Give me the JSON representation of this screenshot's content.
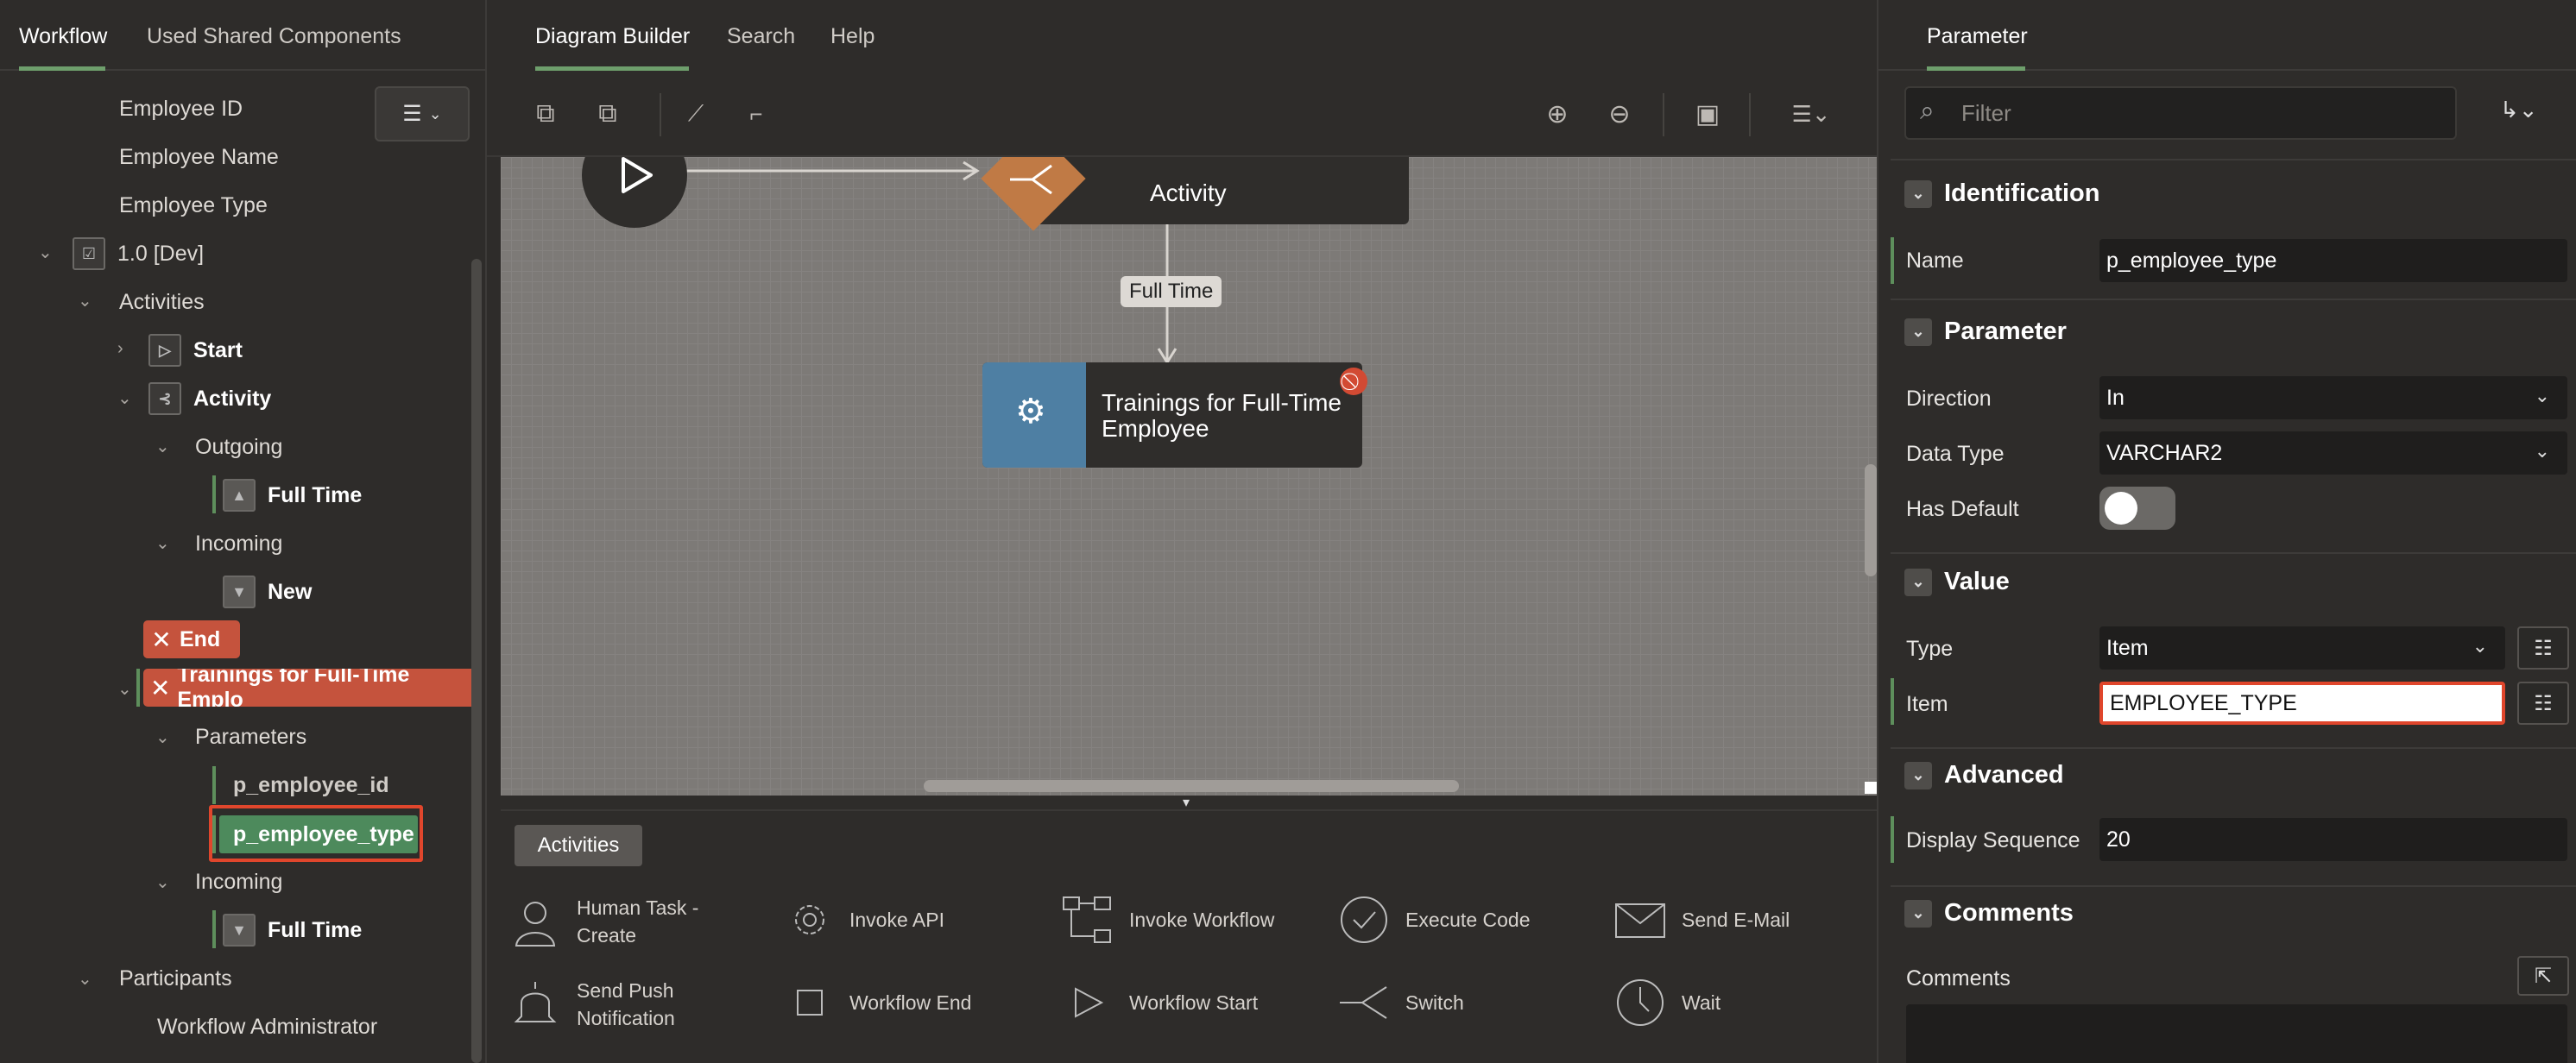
{
  "left_panel": {
    "tabs": [
      "Workflow",
      "Used Shared Components"
    ],
    "tree": {
      "employee_id": "Employee ID",
      "employee_name": "Employee Name",
      "employee_type": "Employee Type",
      "version": "1.0 [Dev]",
      "activities": "Activities",
      "start": "Start",
      "activity": "Activity",
      "outgoing": "Outgoing",
      "full_time_out": "Full Time",
      "incoming": "Incoming",
      "new": "New",
      "end": "End",
      "trainings": "Trainings for Full-Time Emplo",
      "parameters": "Parameters",
      "p_employee_id": "p_employee_id",
      "p_employee_type": "p_employee_type",
      "incoming2": "Incoming",
      "full_time_in": "Full Time",
      "participants": "Participants",
      "workflow_admin": "Workflow Administrator"
    }
  },
  "center": {
    "tabs": [
      "Diagram Builder",
      "Search",
      "Help"
    ],
    "diagram": {
      "activity_label": "Activity",
      "connection_label": "Full Time",
      "trainings_line1": "Trainings for Full-Time",
      "trainings_line2": "Employee"
    },
    "palette": {
      "tab": "Activities",
      "items": [
        {
          "label1": "Human Task -",
          "label2": "Create",
          "icon": "person-icon"
        },
        {
          "label1": "Invoke API",
          "label2": "",
          "icon": "gear-icon"
        },
        {
          "label1": "Invoke Workflow",
          "label2": "",
          "icon": "workflow-icon"
        },
        {
          "label1": "Execute Code",
          "label2": "",
          "icon": "check-circle-icon"
        },
        {
          "label1": "Send E-Mail",
          "label2": "",
          "icon": "envelope-icon"
        },
        {
          "label1": "Send Push",
          "label2": "Notification",
          "icon": "bell-icon"
        },
        {
          "label1": "Workflow End",
          "label2": "",
          "icon": "square-icon"
        },
        {
          "label1": "Workflow Start",
          "label2": "",
          "icon": "play-icon"
        },
        {
          "label1": "Switch",
          "label2": "",
          "icon": "switch-icon"
        },
        {
          "label1": "Wait",
          "label2": "",
          "icon": "clock-icon"
        }
      ]
    }
  },
  "right_panel": {
    "tab": "Parameter",
    "filter_placeholder": "Filter",
    "sections": {
      "identification": "Identification",
      "parameter": "Parameter",
      "value": "Value",
      "advanced": "Advanced",
      "comments": "Comments"
    },
    "fields": {
      "name_label": "Name",
      "name_value": "p_employee_type",
      "direction_label": "Direction",
      "direction_value": "In",
      "data_type_label": "Data Type",
      "data_type_value": "VARCHAR2",
      "has_default_label": "Has Default",
      "type_label": "Type",
      "type_value": "Item",
      "item_label": "Item",
      "item_value": "EMPLOYEE_TYPE",
      "display_seq_label": "Display Sequence",
      "display_seq_value": "20",
      "comments_label": "Comments"
    }
  },
  "colors": {
    "accent_green": "#5e8f5c",
    "error_red": "#c5533d",
    "highlight_red": "#e0462c"
  }
}
